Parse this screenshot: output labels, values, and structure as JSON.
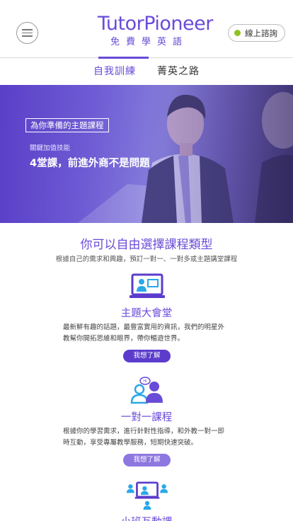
{
  "header": {
    "logo_main": "TutorPioneer",
    "logo_sub": "免費學英語",
    "consult_label": "線上諮詢"
  },
  "tabs": [
    {
      "label": "自我訓練",
      "active": true
    },
    {
      "label": "菁英之路",
      "active": false
    }
  ],
  "hero": {
    "tag": "為你準備的主題課程",
    "small": "關鍵加值技能",
    "title": "4堂課，前進外商不是問題"
  },
  "section": {
    "title": "你可以自由選擇課程類型",
    "subtitle": "根據自己的需求和興趣，預訂一對一、一對多或主題講堂課程"
  },
  "courses": [
    {
      "icon": "lecture-screen-icon",
      "title": "主題大會堂",
      "desc": "最新鮮有趣的話題，最豐富實用的資訊，我們的明星外教幫你開拓思維和眼界，帶你暢遊世界。",
      "button": "我想了解"
    },
    {
      "icon": "one-on-one-chat-icon",
      "title": "一對一課程",
      "desc": "根據你的學習需求，進行針對性指導，和外教一對一即時互動，享受專屬教學服務，短期快速突破。",
      "button": "我想了解"
    },
    {
      "icon": "group-class-icon",
      "title": "小班互動課"
    }
  ],
  "colors": {
    "brand": "#6a4bd8",
    "online_dot": "#8dc21f",
    "icon_blue": "#2aa8e8"
  }
}
